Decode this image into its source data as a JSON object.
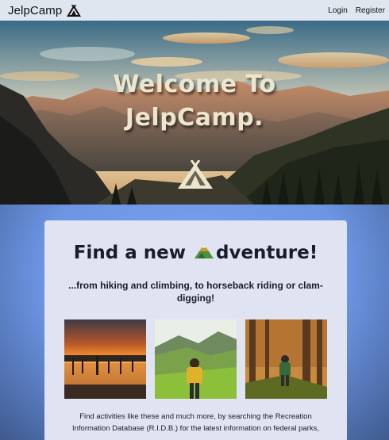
{
  "navbar": {
    "brand": "JelpCamp",
    "brand_icon": "tent-icon",
    "links": [
      "Login",
      "Register"
    ]
  },
  "hero": {
    "title_line1": "Welcome To",
    "title_line2": "JelpCamp.",
    "icon": "tent-icon"
  },
  "card": {
    "heading_before": "Find a new ",
    "heading_icon": "mountain-icon",
    "heading_after": "dventure!",
    "subheading": "...from hiking and climbing, to horseback riding or clam-digging!",
    "photos": [
      "sunset-lake-photo",
      "hiker-meadow-photo",
      "forest-trail-photo"
    ],
    "body": "Find activities like these and much more, by searching the Recreation Information Database (R.I.D.B.) for the latest information on federal parks,"
  },
  "colors": {
    "navbar_bg": "#dfe6ef",
    "page_bg": "#6a8fd8",
    "card_bg": "#dfe3f2",
    "hero_title": "#ece6cf"
  }
}
